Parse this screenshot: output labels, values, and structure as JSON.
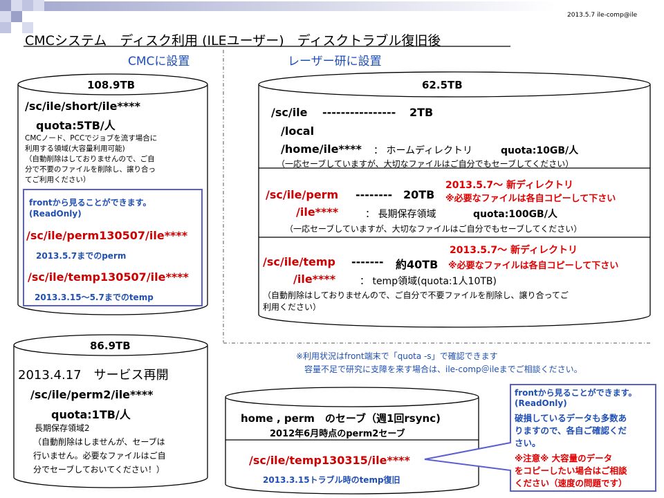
{
  "header": {
    "date_author": "2013.5.7  ile-comp@ile",
    "title": "CMCシステム　ディスク利用 (ILEユーザー)　ディスクトラブル復旧後"
  },
  "sections": {
    "cmc_label": "CMCに設置",
    "laser_label": "レーザー研に設置"
  },
  "disk_cmc": {
    "capacity": "108.9TB",
    "path": "/sc/ile/short/ile****",
    "quota": "quota:5TB/人",
    "desc": [
      "CMCノード、PCCでジョブを流す場合に",
      "利用する領域(大容量利用可能)",
      "（自動削除はしておりませんので、ご自",
      "分で不要のファイルを削除し、譲り合っ",
      "てご利用ください）"
    ],
    "box_note1": "frontから見ることができます。",
    "box_note2": "(ReadOnly)",
    "perm_path": "/sc/ile/perm130507/ile****",
    "perm_note": "2013.5.7までのperm",
    "temp_path": "/sc/ile/temp130507/ile****",
    "temp_note": "2013.3.15～5.7までのtemp"
  },
  "disk_laser": {
    "capacity": "62.5TB",
    "s1_line1_path": "/sc/ile",
    "s1_line1_dash": "----------------",
    "s1_line1_size": "2TB",
    "s1_line2": "/local",
    "s1_line3_path": "/home/ile****",
    "s1_line3_desc": "：  ホームディレクトリ",
    "s1_line3_quota": "quota:10GB/人",
    "s1_note": "（一応セーブしていますが、大切なファイルはご自分でもセーブしてください）",
    "s2_path": "/sc/ile/perm",
    "s2_dash": "--------",
    "s2_size": "20TB",
    "s2_new1": "2013.5.7～ 新ディレクトリ",
    "s2_new2": "※必要なファイルは各自コピーして下さい",
    "s2_sub": "/ile****",
    "s2_desc": "：  長期保存領域",
    "s2_quota": "quota:100GB/人",
    "s2_note": "（一応セーブしていますが、大切なファイルはご自分でもセーブしてください）",
    "s3_path": "/sc/ile/temp",
    "s3_dash": "-------",
    "s3_size": "約40TB",
    "s3_new1": "2013.5.7～ 新ディレクトリ",
    "s3_new2": "※必要なファイルは各自コピーして下さい",
    "s3_sub": "/ile****",
    "s3_desc": "：  temp領域(quota:1人10TB)",
    "s3_note1": "（自動削除はしておりませんので、ご自分で不要ファイルを削除し、譲り合ってご",
    "s3_note2": "利用ください）"
  },
  "disk_perm2": {
    "capacity": "86.9TB",
    "service": "2013.4.17　サービス再開",
    "path": "/sc/ile/perm2/ile****",
    "quota": "quota:1TB/人",
    "desc": [
      "長期保存領域2",
      "（自動削除はしませんが、セーブは",
      "行いません。必要なファイルはご自",
      "分でセーブしておいてください！）"
    ]
  },
  "usage_note": {
    "line1": "※利用状況はfront端末で「quota  -s」で確認できます",
    "line2": "容量不足で研究に支障を来す場合は、ile-comp＠ileまでご相談ください。"
  },
  "disk_save": {
    "title1": "home , perm　のセーブ（週1回rsync)",
    "title2": "2012年6月時点のperm2セーブ",
    "path": "/sc/ile/temp130315/ile****",
    "note": "2013.3.15トラブル時のtemp復旧"
  },
  "callout": {
    "blue1": "frontから見ることができます。",
    "blue2": "(ReadOnly)",
    "blue3": "破損しているデータも多数あ",
    "blue4": "りますので、各自ご確認くだ",
    "blue5": "さい。",
    "red1": "※注意※  大容量のデータ",
    "red2": "をコピーしたい場合はご相談",
    "red3": "ください（速度の問題です）"
  },
  "colors": {
    "blue_text": "#1f4fb5",
    "red_text": "#e00000",
    "box_border": "#5a5fd0",
    "deco_dark": "#9aa0c8",
    "deco_light": "#d8dbee"
  }
}
